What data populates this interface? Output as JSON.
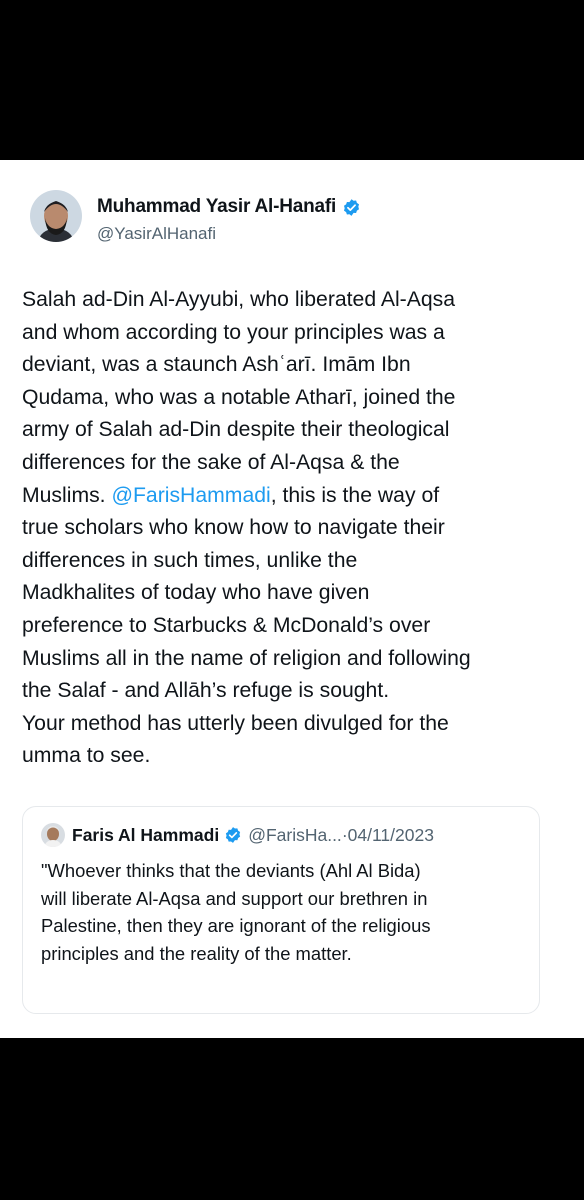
{
  "tweet": {
    "author": {
      "display_name": "Muhammad Yasir Al-Hanafi",
      "handle": "@YasirAlHanafi",
      "verified_icon": "verified-badge-icon",
      "badge_color": "#1d9bf0"
    },
    "body_lines": [
      [
        "Salah ad-Din Al-Ayyubi, who liberated Al-Aqsa"
      ],
      [
        "and whom according to your principles was a"
      ],
      [
        "deviant, was a staunch Ashʿarī. Imām Ibn"
      ],
      [
        "Qudama, who was a notable Atharī, joined the"
      ],
      [
        "army of Salah ad-Din despite their theological"
      ],
      [
        "differences for the sake of Al-Aqsa & the"
      ],
      [
        "Muslims. ",
        "@FarisHammadi",
        ", this is the way of"
      ],
      [
        "true scholars who know how to navigate their"
      ],
      [
        "differences in such times, unlike the"
      ],
      [
        "Madkhalites of today who have given"
      ],
      [
        "preference to Starbucks & McDonald’s over"
      ],
      [
        "Muslims all in the name of religion and following"
      ],
      [
        "the Salaf - and Allāh’s refuge is sought."
      ],
      [
        "Your method has utterly been divulged for the"
      ],
      [
        "umma to see."
      ]
    ]
  },
  "quoted_tweet": {
    "author": {
      "display_name": "Faris Al Hammadi",
      "handle": "@FarisHa...",
      "separator": "·",
      "date": "04/11/2023",
      "verified_icon": "verified-badge-icon"
    },
    "body_lines": [
      "\"Whoever thinks that the deviants (Ahl Al Bida)",
      "will liberate Al-Aqsa and support our brethren in",
      "Palestine, then they are ignorant of the religious",
      "principles and the reality of the matter."
    ]
  },
  "colors": {
    "background": "#000000",
    "card": "#ffffff",
    "text": "#0f1419",
    "secondary_text": "#536471",
    "link": "#1d9bf0"
  }
}
